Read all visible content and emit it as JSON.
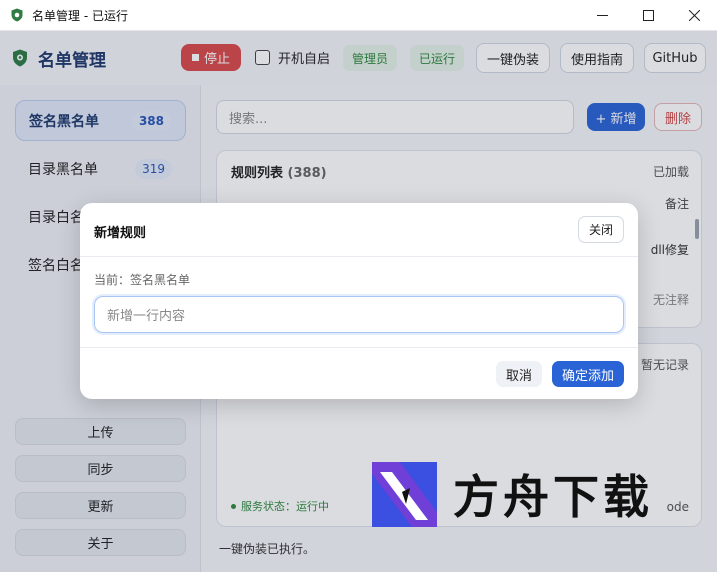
{
  "window": {
    "title": "名单管理 - 已运行",
    "controls": [
      "minimize",
      "maximize",
      "close"
    ]
  },
  "header": {
    "app_name": "名单管理",
    "stop_label": "停止",
    "autostart_label": "开机自启",
    "autostart_checked": false,
    "admin_badge": "管理员",
    "running_badge": "已运行",
    "disguise_label": "一键伪装",
    "guide_label": "使用指南",
    "github_label": "GitHub"
  },
  "sidebar": {
    "items": [
      {
        "label": "签名黑名单",
        "count": "388",
        "active": true
      },
      {
        "label": "目录黑名单",
        "count": "319",
        "active": false
      },
      {
        "label": "目录白名单",
        "count": "",
        "active": false
      },
      {
        "label": "签名白名单",
        "count": "",
        "active": false
      }
    ],
    "buttons": [
      "上传",
      "同步",
      "更新",
      "关于"
    ]
  },
  "main": {
    "search_placeholder": "搜索...",
    "new_label": "+ 新增",
    "delete_label": "删除",
    "rules_card": {
      "title": "规则列表",
      "count": "(388)",
      "status": "已加载",
      "note_header": "备注",
      "row1_note": "dll修复",
      "row2_note": "无注释"
    },
    "log_card": {
      "empty_text": "暂无记录",
      "service_status": "服务状态：运行中",
      "mode_text": "ode"
    },
    "footer_message": "一键伪装已执行。"
  },
  "dialog": {
    "title": "新增规则",
    "close_label": "关闭",
    "current_label": "当前：签名黑名单",
    "input_placeholder": "新增一行内容",
    "cancel_label": "取消",
    "confirm_label": "确定添加"
  },
  "watermark": {
    "text": "方舟下载"
  },
  "colors": {
    "accent": "#2a63d6",
    "danger": "#d84a4a",
    "success": "#2f8a3f",
    "brand_text": "#1f3a6d"
  }
}
